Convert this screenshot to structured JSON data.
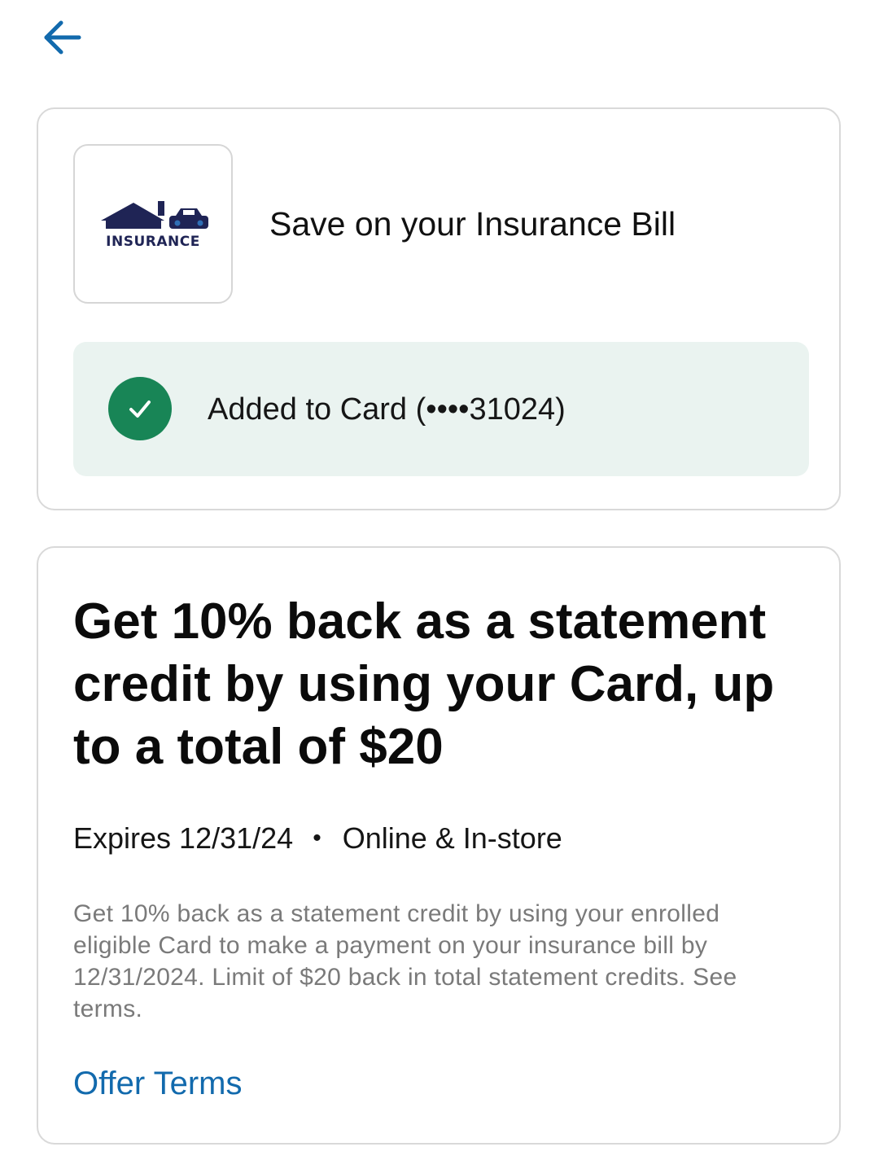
{
  "header": {
    "back_icon": "arrow-left-icon",
    "accent_color": "#126aad"
  },
  "merchant": {
    "logo_text": "INSURANCE",
    "logo_icon": "house-car-logo",
    "title": "Save on your Insurance Bill"
  },
  "status": {
    "icon": "check-circle-icon",
    "icon_color": "#188556",
    "text": "Added to Card (••••31024)"
  },
  "offer": {
    "headline": "Get 10% back as a statement credit by using your Card, up to a total of $20",
    "expires": "Expires 12/31/24",
    "separator": "•",
    "channel": "Online & In-store",
    "description": "Get 10% back as a statement credit by using your enrolled eligible Card to make a payment on your insurance bill by 12/31/2024. Limit of $20 back in total statement credits. See terms.",
    "terms_link": "Offer Terms"
  }
}
